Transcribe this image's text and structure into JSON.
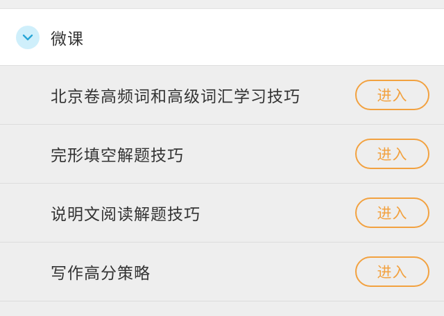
{
  "section": {
    "title": "微课",
    "icon": "chevron-down-icon",
    "accent_color": "#cfeffb"
  },
  "lessons": [
    {
      "label": "北京卷高频词和高级词汇学习技巧",
      "button": "进入"
    },
    {
      "label": "完形填空解题技巧",
      "button": "进入"
    },
    {
      "label": "说明文阅读解题技巧",
      "button": "进入"
    },
    {
      "label": "写作高分策略",
      "button": "进入"
    }
  ],
  "colors": {
    "button_orange": "#f2a13f",
    "text": "#333333",
    "background": "#eeeeee"
  }
}
